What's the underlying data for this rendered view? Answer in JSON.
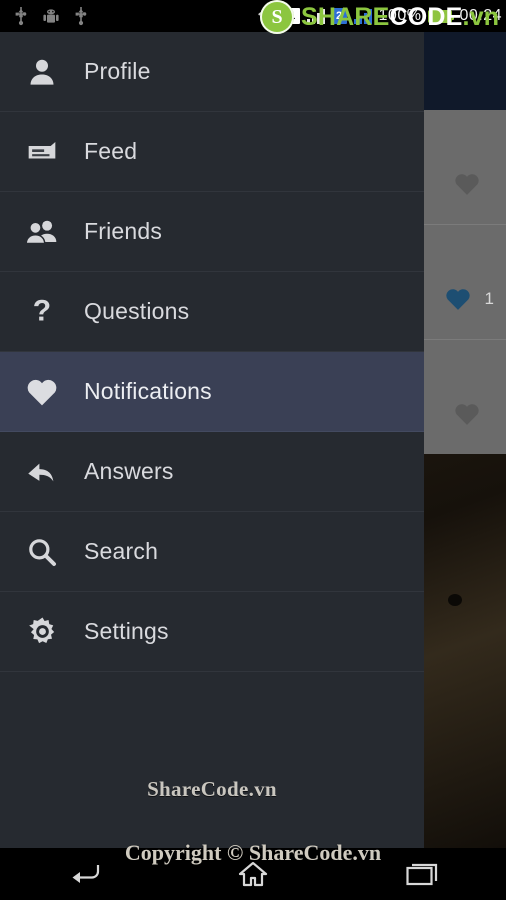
{
  "status_bar": {
    "left_icons": [
      "usb-icon",
      "android-icon",
      "usb-icon"
    ],
    "wifi_icon": "wifi-icon",
    "sim1_label": "1",
    "sim2_label": "2",
    "battery_percent": "100%",
    "time": "00:24"
  },
  "drawer": {
    "items": [
      {
        "label": "Profile",
        "icon": "person-icon",
        "active": false
      },
      {
        "label": "Feed",
        "icon": "feed-icon",
        "active": false
      },
      {
        "label": "Friends",
        "icon": "friends-icon",
        "active": false
      },
      {
        "label": "Questions",
        "icon": "question-icon",
        "active": false
      },
      {
        "label": "Notifications",
        "icon": "heart-icon",
        "active": true
      },
      {
        "label": "Answers",
        "icon": "reply-icon",
        "active": false
      },
      {
        "label": "Search",
        "icon": "search-icon",
        "active": false
      },
      {
        "label": "Settings",
        "icon": "gear-icon",
        "active": false
      }
    ],
    "footer_text": "ShareCode.vn",
    "background": "#262a30",
    "active_background": "#3a4055",
    "text_color": "#d9dade"
  },
  "app_content": {
    "header_color": "#10192a",
    "rows": [
      {
        "heart_icon": "heart-icon",
        "heart_color": "#5a5a5a",
        "like_count": ""
      },
      {
        "heart_icon": "heart-icon",
        "heart_color": "#1d4e72",
        "like_count": "1"
      },
      {
        "heart_icon": "heart-icon",
        "heart_color": "#5a5a5a",
        "like_count": ""
      }
    ]
  },
  "nav_bar": {
    "back_label": "back-icon",
    "home_label": "home-icon",
    "recents_label": "recents-icon"
  },
  "watermarks": {
    "top_logo_letter": "S",
    "top_text_part1": "SHARE",
    "top_text_part2": "CODE",
    "top_text_part3": ".vn",
    "bottom_text": "Copyright © ShareCode.vn"
  }
}
